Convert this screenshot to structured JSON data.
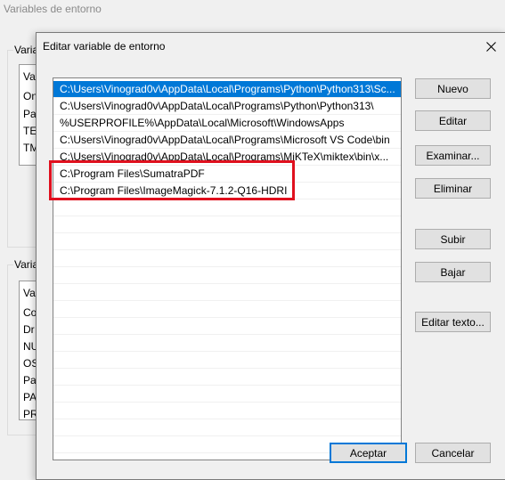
{
  "parent_window": {
    "title": "Variables de entorno",
    "user_group_label": "Varia",
    "user_list_items": [
      "Va",
      "On",
      "Pa",
      "TE",
      "TM"
    ],
    "system_group_label": "Varia",
    "system_list_items": [
      "Var",
      "Co",
      "Dr",
      "NU",
      "OS",
      "Pa",
      "PA",
      "PR"
    ]
  },
  "dialog": {
    "title": "Editar variable de entorno",
    "paths": [
      "C:\\Users\\Vinograd0v\\AppData\\Local\\Programs\\Python\\Python313\\Sc...",
      "C:\\Users\\Vinograd0v\\AppData\\Local\\Programs\\Python\\Python313\\",
      "%USERPROFILE%\\AppData\\Local\\Microsoft\\WindowsApps",
      "C:\\Users\\Vinograd0v\\AppData\\Local\\Programs\\Microsoft VS Code\\bin",
      "C:\\Users\\Vinograd0v\\AppData\\Local\\Programs\\MiKTeX\\miktex\\bin\\x...",
      "C:\\Program Files\\SumatraPDF",
      "C:\\Program Files\\ImageMagick-7.1.2-Q16-HDRI"
    ],
    "selected_index": 0,
    "buttons": {
      "nuevo": "Nuevo",
      "editar": "Editar",
      "examinar": "Examinar...",
      "eliminar": "Eliminar",
      "subir": "Subir",
      "bajar": "Bajar",
      "editar_texto": "Editar texto...",
      "aceptar": "Aceptar",
      "cancelar": "Cancelar"
    },
    "colors": {
      "selection": "#0078d7",
      "highlight": "#e0101e"
    }
  }
}
